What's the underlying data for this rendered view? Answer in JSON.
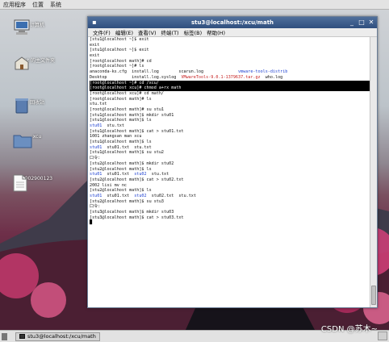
{
  "top_panel": {
    "menus": [
      "应用程序",
      "位置",
      "系统"
    ]
  },
  "desktop": {
    "icons": [
      {
        "label": "计算机",
        "icon": "computer-icon"
      },
      {
        "label": "root 的主文件夹",
        "icon": "home-folder-icon"
      },
      {
        "label": "回收站",
        "icon": "trash-icon"
      },
      {
        "label": "xcu",
        "icon": "folder-icon"
      },
      {
        "label": "5002900123",
        "icon": "document-icon"
      }
    ]
  },
  "terminal": {
    "title": "stu3@localhost:/xcu/math",
    "menu": [
      "文件(F)",
      "编辑(E)",
      "查看(V)",
      "终端(T)",
      "标签(B)",
      "帮助(H)"
    ],
    "colors": {
      "blue": "#1c3fd0",
      "green": "#157b2a",
      "highlight_bg": "#000000",
      "highlight_fg": "#ffffff"
    },
    "lines": [
      [
        {
          "t": "[stu1@localhost ~]$ exit"
        }
      ],
      [
        {
          "t": "exit"
        }
      ],
      [
        {
          "t": "[stu1@localhost ~]$ exit"
        }
      ],
      [
        {
          "t": "exit"
        }
      ],
      [
        {
          "t": "[root@localhost math]# cd"
        }
      ],
      [
        {
          "t": "[root@localhost ~]# ls"
        }
      ],
      [
        {
          "t": "anaconda-ks.cfg  install.log        scarun.log              "
        },
        {
          "t": "vmware-tools-distrib",
          "c": "blue"
        }
      ],
      [
        {
          "t": "Desktop          install.log.syslog  "
        },
        {
          "t": "VMwareTools-9.0.1-1379637.tar.gz",
          "c": "red"
        },
        {
          "t": "  who.log"
        }
      ],
      [
        {
          "t": "[root@localhost ~]# cd /xcu/",
          "hl": true
        }
      ],
      [
        {
          "t": "[root@localhost xcu]# chmod a+rx math",
          "hl": true
        }
      ],
      [
        {
          "t": "[root@localhost xcu]# cd math/"
        }
      ],
      [
        {
          "t": "[root@localhost math]# ls"
        }
      ],
      [
        {
          "t": "stu.txt"
        }
      ],
      [
        {
          "t": "[root@localhost math]# su stu1"
        }
      ],
      [
        {
          "t": "[stu1@localhost math]$ mkdir stu01"
        }
      ],
      [
        {
          "t": "[stu1@localhost math]$ ls"
        }
      ],
      [
        {
          "t": "stu01",
          "c": "blue"
        },
        {
          "t": "  stu.txt"
        }
      ],
      [
        {
          "t": "[stu1@localhost math]$ cat > stu01.txt"
        }
      ],
      [
        {
          "t": "1001 zhangsan man xcu"
        }
      ],
      [
        {
          "t": "[stu1@localhost math]$ ls"
        }
      ],
      [
        {
          "t": "stu01",
          "c": "blue"
        },
        {
          "t": "  stu01.txt  stu.txt"
        }
      ],
      [
        {
          "t": "[stu1@localhost math]$ su stu2"
        }
      ],
      [
        {
          "t": "口令:"
        }
      ],
      [
        {
          "t": "[stu2@localhost math]$ mkdir stu02"
        }
      ],
      [
        {
          "t": "[stu2@localhost math]$ ls"
        }
      ],
      [
        {
          "t": "stu01",
          "c": "blue"
        },
        {
          "t": "  stu01.txt  "
        },
        {
          "t": "stu02",
          "c": "blue"
        },
        {
          "t": "  stu.txt"
        }
      ],
      [
        {
          "t": "[stu2@localhost math]$ cat > stu02.txt"
        }
      ],
      [
        {
          "t": "2002 lisi mv nc"
        }
      ],
      [
        {
          "t": "[stu2@localhost math]$ ls"
        }
      ],
      [
        {
          "t": "stu01",
          "c": "blue"
        },
        {
          "t": "  stu01.txt  "
        },
        {
          "t": "stu02",
          "c": "blue"
        },
        {
          "t": "  stu02.txt  stu.txt"
        }
      ],
      [
        {
          "t": "[stu2@localhost math]$ su stu3"
        }
      ],
      [
        {
          "t": "口令:"
        }
      ],
      [
        {
          "t": "[stu3@localhost math]$ mkdir stu03"
        }
      ],
      [
        {
          "t": "[stu3@localhost math]$ cat > stu03.txt"
        }
      ],
      [
        {
          "t": "█",
          "c": "cursor"
        }
      ]
    ]
  },
  "taskbar": {
    "task_label": "stu3@localhost:/xcu/math"
  },
  "watermark": "CSDN @苏木~"
}
